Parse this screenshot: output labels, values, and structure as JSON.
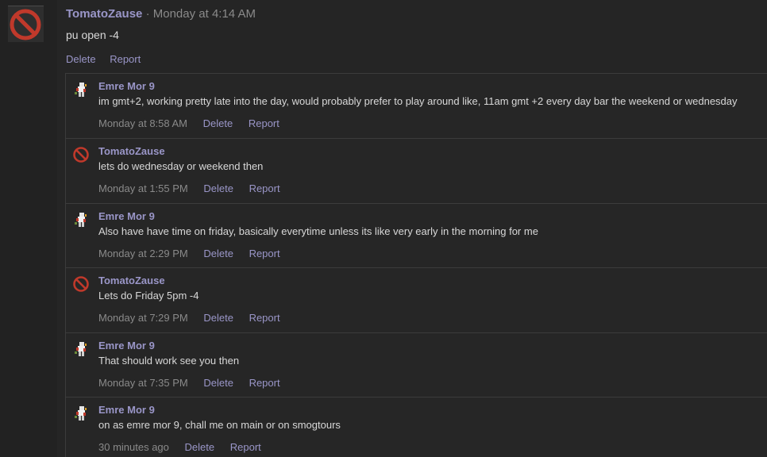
{
  "post": {
    "author": "TomatoZause",
    "separator": "·",
    "time": "Monday at 4:14 AM",
    "body": "pu open -4",
    "actions": {
      "delete": "Delete",
      "report": "Report"
    }
  },
  "comments": [
    {
      "author": "Emre Mor 9",
      "avatar": "sprite-avatar-icon",
      "text": "im gmt+2, working pretty late into the day, would probably prefer to play around like, 11am gmt +2 every day bar the weekend or wednesday",
      "time": "Monday at 8:58 AM",
      "delete": "Delete",
      "report": "Report"
    },
    {
      "author": "TomatoZause",
      "avatar": "prohibited-icon",
      "text": "lets do wednesday or weekend then",
      "time": "Monday at 1:55 PM",
      "delete": "Delete",
      "report": "Report"
    },
    {
      "author": "Emre Mor 9",
      "avatar": "sprite-avatar-icon",
      "text": "Also have have time on friday, basically everytime unless its like very early in the morning for me",
      "time": "Monday at 2:29 PM",
      "delete": "Delete",
      "report": "Report"
    },
    {
      "author": "TomatoZause",
      "avatar": "prohibited-icon",
      "text": "Lets do Friday 5pm -4",
      "time": "Monday at 7:29 PM",
      "delete": "Delete",
      "report": "Report"
    },
    {
      "author": "Emre Mor 9",
      "avatar": "sprite-avatar-icon",
      "text": "That should work see you then",
      "time": "Monday at 7:35 PM",
      "delete": "Delete",
      "report": "Report"
    },
    {
      "author": "Emre Mor 9",
      "avatar": "sprite-avatar-icon",
      "text": "on as emre mor 9, chall me on main or on smogtours",
      "time": "30 minutes ago",
      "delete": "Delete",
      "report": "Report"
    }
  ],
  "colors": {
    "background": "#252525",
    "username": "#9a96c8",
    "text": "#d8d8d8",
    "muted": "#8a8a8a",
    "prohibited_red": "#c0392b"
  }
}
